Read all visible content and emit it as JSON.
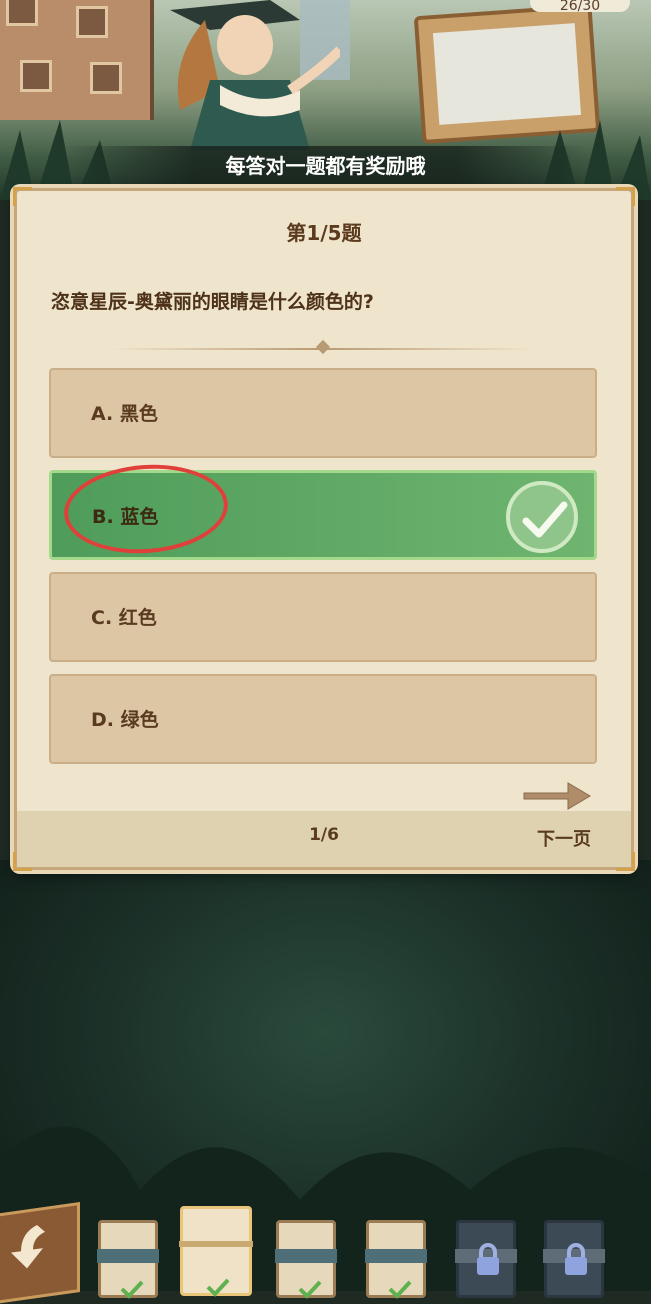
{
  "header": {
    "counter": "26/30",
    "banner": "每答对一题都有奖励哦"
  },
  "quiz": {
    "title": "第1/5题",
    "question": "恣意星辰-奥黛丽的眼睛是什么颜色的?",
    "options": [
      {
        "label": "A. 黑色",
        "state": "normal"
      },
      {
        "label": "B. 蓝色",
        "state": "correct"
      },
      {
        "label": "C. 红色",
        "state": "normal"
      },
      {
        "label": "D. 绿色",
        "state": "normal"
      }
    ],
    "page": "1/6",
    "next": "下一页"
  },
  "nav_cards": [
    {
      "state": "completed"
    },
    {
      "state": "current"
    },
    {
      "state": "completed"
    },
    {
      "state": "completed"
    },
    {
      "state": "locked"
    },
    {
      "state": "locked"
    }
  ],
  "colors": {
    "correct": "#5fa866",
    "highlight_ring": "#e0403a",
    "panel": "#efe4cc"
  }
}
